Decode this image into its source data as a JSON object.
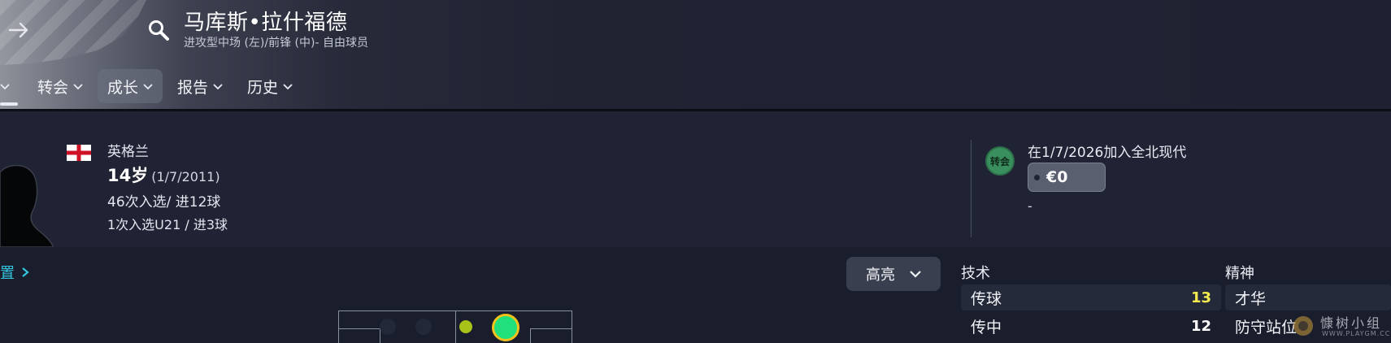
{
  "header": {
    "player_name": "马库斯•拉什福德",
    "position_text": "进攻型中场 (左)/前锋 (中)- 自由球员",
    "tabs": [
      {
        "label": "",
        "active": false
      },
      {
        "label": "转会",
        "active": false
      },
      {
        "label": "成长",
        "active": true
      },
      {
        "label": "报告",
        "active": false
      },
      {
        "label": "历史",
        "active": false
      }
    ]
  },
  "profile": {
    "nationality": "英格兰",
    "age": "14岁",
    "dob": "(1/7/2011)",
    "caps": "46次入选/ 进12球",
    "u21_caps": "1次入选U21 / 进3球"
  },
  "transfer": {
    "badge_label": "转会",
    "badge_color": "#3a8f5e",
    "joined_text": "在1/7/2026加入全北现代",
    "fee": "€0",
    "fee_sub": "-"
  },
  "lower": {
    "section_link_label": "置",
    "highlight_button_label": "高亮",
    "columns": {
      "technical_header": "技术",
      "mental_header": "精神"
    },
    "technical": [
      {
        "name": "传球",
        "value": "13",
        "color": "#f4e94d"
      },
      {
        "name": "传中",
        "value": "12",
        "color": "#ffffff"
      }
    ],
    "mental": [
      {
        "name": "才华"
      },
      {
        "name": "防守站位"
      }
    ]
  },
  "watermark": {
    "text": "慷树小组",
    "sub": "WWW.PLAYGM.CC"
  },
  "colors": {
    "accent_link": "#33c5e0",
    "position_primary": "#1fe07a",
    "position_secondary": "#a8c21a"
  }
}
